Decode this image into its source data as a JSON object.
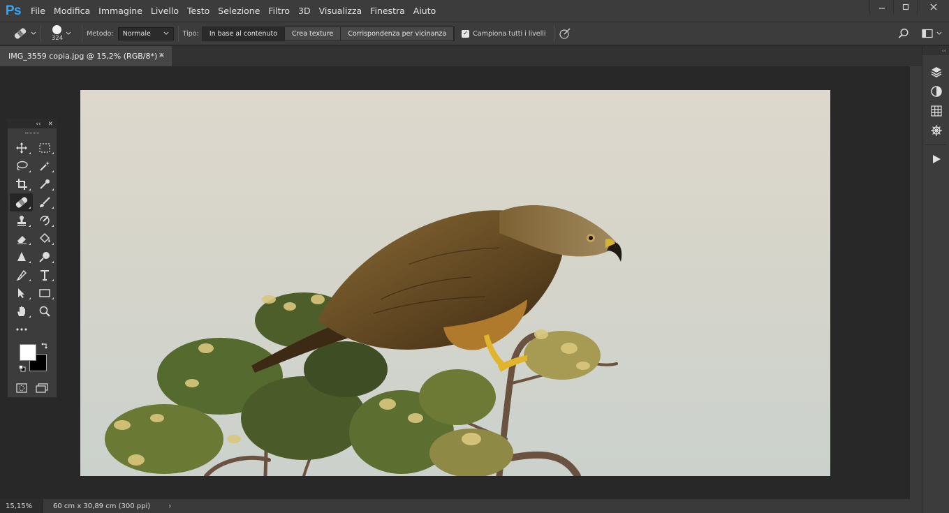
{
  "app": {
    "logo": "Ps"
  },
  "menu": [
    "File",
    "Modifica",
    "Immagine",
    "Livello",
    "Testo",
    "Selezione",
    "Filtro",
    "3D",
    "Visualizza",
    "Finestra",
    "Aiuto"
  ],
  "window_controls": [
    "minimize",
    "maximize",
    "close"
  ],
  "options": {
    "brush_size": "324",
    "metodo_label": "Metodo:",
    "metodo_value": "Normale",
    "tipo_label": "Tipo:",
    "tipo_options": [
      "In base al contenuto",
      "Crea texture",
      "Corrispondenza per vicinanza"
    ],
    "tipo_selected": "In base al contenuto",
    "sample_all_label": "Campiona tutti i livelli",
    "sample_all_checked": true
  },
  "document": {
    "tab_title": "IMG_3559 copia.jpg @ 15,2% (RGB/8*) *",
    "image_subject": "bird-of-prey-on-branch"
  },
  "status": {
    "zoom": "15,15%",
    "doc_size": "60 cm x 30,89 cm (300 ppi)"
  },
  "tools": [
    "move",
    "marquee",
    "lasso",
    "magic-wand",
    "crop",
    "eyedropper",
    "spot-healing",
    "brush",
    "clone-stamp",
    "history-brush",
    "eraser",
    "paint-bucket",
    "blur",
    "dodge",
    "pen",
    "type",
    "path-selection",
    "rectangle",
    "hand",
    "zoom",
    "more"
  ],
  "colors": {
    "foreground": "#ffffff",
    "background": "#000000",
    "accent": "#31a8ff"
  },
  "right_panel_icons": [
    "layers-icon",
    "adjustments-icon",
    "swatches-icon",
    "navigator-icon",
    "play-icon"
  ]
}
